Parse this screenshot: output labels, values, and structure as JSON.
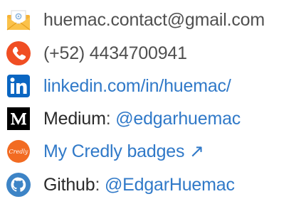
{
  "colors": {
    "text_primary": "#2a2a2a",
    "text_secondary": "#505050",
    "link": "#3079c8",
    "phone_icon": "#f04e23",
    "linkedin_icon": "#0a66c2",
    "credly_icon": "#f26b22",
    "github_icon": "#3d84c6"
  },
  "contacts": [
    {
      "icon": "envelope-icon",
      "text": "huemac.contact@gmail.com"
    },
    {
      "icon": "phone-icon",
      "text": "(+52) 4434700941"
    },
    {
      "icon": "linkedin-icon",
      "link": "linkedin.com/in/huemac/"
    },
    {
      "icon": "medium-icon",
      "label": "Medium",
      "separator": ": ",
      "link": "@edgarhuemac"
    },
    {
      "icon": "credly-icon",
      "icon_text": "Credly",
      "link": "My Credly badges ↗"
    },
    {
      "icon": "github-icon",
      "label": "Github",
      "separator": ": ",
      "link": "@EdgarHuemac"
    }
  ]
}
